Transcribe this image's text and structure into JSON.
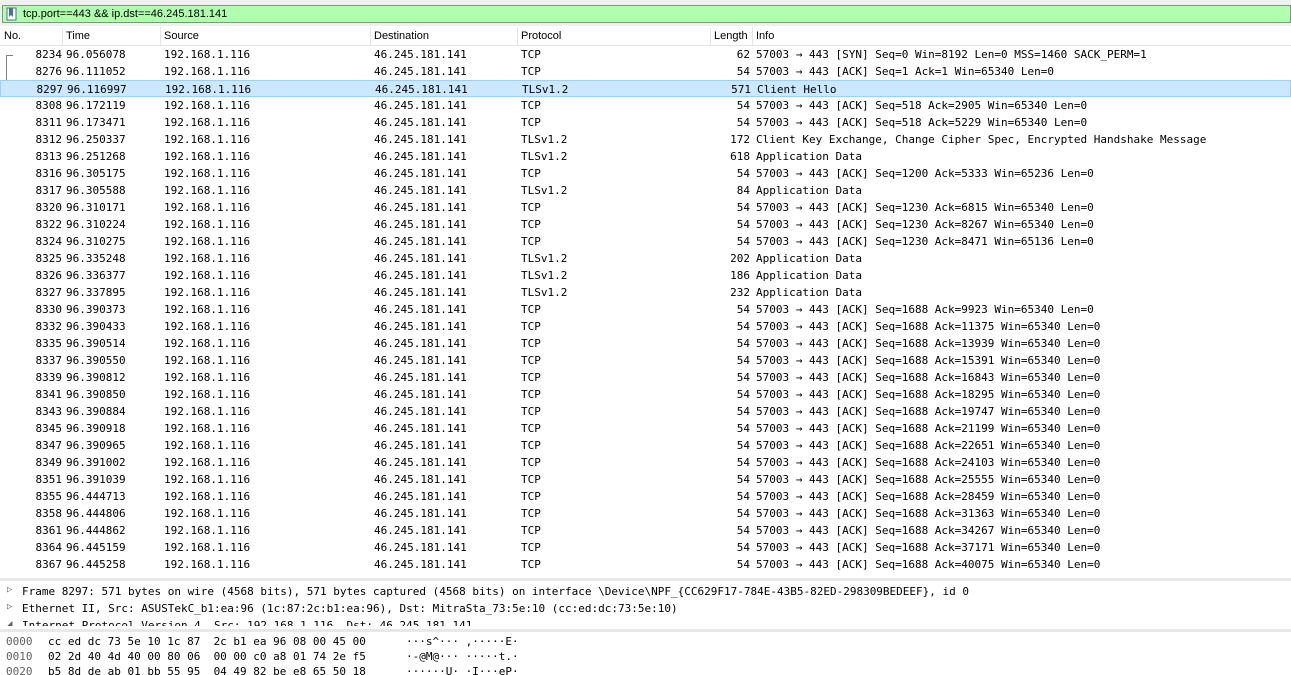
{
  "filter": {
    "value": "tcp.port==443 && ip.dst==46.245.181.141",
    "color": "#afffaf"
  },
  "columns": {
    "no": "No.",
    "time": "Time",
    "source": "Source",
    "destination": "Destination",
    "protocol": "Protocol",
    "length": "Length",
    "info": "Info"
  },
  "packets": [
    {
      "no": "8234",
      "time": "96.056078",
      "source": "192.168.1.116",
      "destination": "46.245.181.141",
      "protocol": "TCP",
      "length": "62",
      "info": "57003 → 443 [SYN] Seq=0 Win=8192 Len=0 MSS=1460 SACK_PERM=1"
    },
    {
      "no": "8276",
      "time": "96.111052",
      "source": "192.168.1.116",
      "destination": "46.245.181.141",
      "protocol": "TCP",
      "length": "54",
      "info": "57003 → 443 [ACK] Seq=1 Ack=1 Win=65340 Len=0"
    },
    {
      "no": "8297",
      "time": "96.116997",
      "source": "192.168.1.116",
      "destination": "46.245.181.141",
      "protocol": "TLSv1.2",
      "length": "571",
      "info": "Client Hello"
    },
    {
      "no": "8308",
      "time": "96.172119",
      "source": "192.168.1.116",
      "destination": "46.245.181.141",
      "protocol": "TCP",
      "length": "54",
      "info": "57003 → 443 [ACK] Seq=518 Ack=2905 Win=65340 Len=0"
    },
    {
      "no": "8311",
      "time": "96.173471",
      "source": "192.168.1.116",
      "destination": "46.245.181.141",
      "protocol": "TCP",
      "length": "54",
      "info": "57003 → 443 [ACK] Seq=518 Ack=5229 Win=65340 Len=0"
    },
    {
      "no": "8312",
      "time": "96.250337",
      "source": "192.168.1.116",
      "destination": "46.245.181.141",
      "protocol": "TLSv1.2",
      "length": "172",
      "info": "Client Key Exchange, Change Cipher Spec, Encrypted Handshake Message"
    },
    {
      "no": "8313",
      "time": "96.251268",
      "source": "192.168.1.116",
      "destination": "46.245.181.141",
      "protocol": "TLSv1.2",
      "length": "618",
      "info": "Application Data"
    },
    {
      "no": "8316",
      "time": "96.305175",
      "source": "192.168.1.116",
      "destination": "46.245.181.141",
      "protocol": "TCP",
      "length": "54",
      "info": "57003 → 443 [ACK] Seq=1200 Ack=5333 Win=65236 Len=0"
    },
    {
      "no": "8317",
      "time": "96.305588",
      "source": "192.168.1.116",
      "destination": "46.245.181.141",
      "protocol": "TLSv1.2",
      "length": "84",
      "info": "Application Data"
    },
    {
      "no": "8320",
      "time": "96.310171",
      "source": "192.168.1.116",
      "destination": "46.245.181.141",
      "protocol": "TCP",
      "length": "54",
      "info": "57003 → 443 [ACK] Seq=1230 Ack=6815 Win=65340 Len=0"
    },
    {
      "no": "8322",
      "time": "96.310224",
      "source": "192.168.1.116",
      "destination": "46.245.181.141",
      "protocol": "TCP",
      "length": "54",
      "info": "57003 → 443 [ACK] Seq=1230 Ack=8267 Win=65340 Len=0"
    },
    {
      "no": "8324",
      "time": "96.310275",
      "source": "192.168.1.116",
      "destination": "46.245.181.141",
      "protocol": "TCP",
      "length": "54",
      "info": "57003 → 443 [ACK] Seq=1230 Ack=8471 Win=65136 Len=0"
    },
    {
      "no": "8325",
      "time": "96.335248",
      "source": "192.168.1.116",
      "destination": "46.245.181.141",
      "protocol": "TLSv1.2",
      "length": "202",
      "info": "Application Data"
    },
    {
      "no": "8326",
      "time": "96.336377",
      "source": "192.168.1.116",
      "destination": "46.245.181.141",
      "protocol": "TLSv1.2",
      "length": "186",
      "info": "Application Data"
    },
    {
      "no": "8327",
      "time": "96.337895",
      "source": "192.168.1.116",
      "destination": "46.245.181.141",
      "protocol": "TLSv1.2",
      "length": "232",
      "info": "Application Data"
    },
    {
      "no": "8330",
      "time": "96.390373",
      "source": "192.168.1.116",
      "destination": "46.245.181.141",
      "protocol": "TCP",
      "length": "54",
      "info": "57003 → 443 [ACK] Seq=1688 Ack=9923 Win=65340 Len=0"
    },
    {
      "no": "8332",
      "time": "96.390433",
      "source": "192.168.1.116",
      "destination": "46.245.181.141",
      "protocol": "TCP",
      "length": "54",
      "info": "57003 → 443 [ACK] Seq=1688 Ack=11375 Win=65340 Len=0"
    },
    {
      "no": "8335",
      "time": "96.390514",
      "source": "192.168.1.116",
      "destination": "46.245.181.141",
      "protocol": "TCP",
      "length": "54",
      "info": "57003 → 443 [ACK] Seq=1688 Ack=13939 Win=65340 Len=0"
    },
    {
      "no": "8337",
      "time": "96.390550",
      "source": "192.168.1.116",
      "destination": "46.245.181.141",
      "protocol": "TCP",
      "length": "54",
      "info": "57003 → 443 [ACK] Seq=1688 Ack=15391 Win=65340 Len=0"
    },
    {
      "no": "8339",
      "time": "96.390812",
      "source": "192.168.1.116",
      "destination": "46.245.181.141",
      "protocol": "TCP",
      "length": "54",
      "info": "57003 → 443 [ACK] Seq=1688 Ack=16843 Win=65340 Len=0"
    },
    {
      "no": "8341",
      "time": "96.390850",
      "source": "192.168.1.116",
      "destination": "46.245.181.141",
      "protocol": "TCP",
      "length": "54",
      "info": "57003 → 443 [ACK] Seq=1688 Ack=18295 Win=65340 Len=0"
    },
    {
      "no": "8343",
      "time": "96.390884",
      "source": "192.168.1.116",
      "destination": "46.245.181.141",
      "protocol": "TCP",
      "length": "54",
      "info": "57003 → 443 [ACK] Seq=1688 Ack=19747 Win=65340 Len=0"
    },
    {
      "no": "8345",
      "time": "96.390918",
      "source": "192.168.1.116",
      "destination": "46.245.181.141",
      "protocol": "TCP",
      "length": "54",
      "info": "57003 → 443 [ACK] Seq=1688 Ack=21199 Win=65340 Len=0"
    },
    {
      "no": "8347",
      "time": "96.390965",
      "source": "192.168.1.116",
      "destination": "46.245.181.141",
      "protocol": "TCP",
      "length": "54",
      "info": "57003 → 443 [ACK] Seq=1688 Ack=22651 Win=65340 Len=0"
    },
    {
      "no": "8349",
      "time": "96.391002",
      "source": "192.168.1.116",
      "destination": "46.245.181.141",
      "protocol": "TCP",
      "length": "54",
      "info": "57003 → 443 [ACK] Seq=1688 Ack=24103 Win=65340 Len=0"
    },
    {
      "no": "8351",
      "time": "96.391039",
      "source": "192.168.1.116",
      "destination": "46.245.181.141",
      "protocol": "TCP",
      "length": "54",
      "info": "57003 → 443 [ACK] Seq=1688 Ack=25555 Win=65340 Len=0"
    },
    {
      "no": "8355",
      "time": "96.444713",
      "source": "192.168.1.116",
      "destination": "46.245.181.141",
      "protocol": "TCP",
      "length": "54",
      "info": "57003 → 443 [ACK] Seq=1688 Ack=28459 Win=65340 Len=0"
    },
    {
      "no": "8358",
      "time": "96.444806",
      "source": "192.168.1.116",
      "destination": "46.245.181.141",
      "protocol": "TCP",
      "length": "54",
      "info": "57003 → 443 [ACK] Seq=1688 Ack=31363 Win=65340 Len=0"
    },
    {
      "no": "8361",
      "time": "96.444862",
      "source": "192.168.1.116",
      "destination": "46.245.181.141",
      "protocol": "TCP",
      "length": "54",
      "info": "57003 → 443 [ACK] Seq=1688 Ack=34267 Win=65340 Len=0"
    },
    {
      "no": "8364",
      "time": "96.445159",
      "source": "192.168.1.116",
      "destination": "46.245.181.141",
      "protocol": "TCP",
      "length": "54",
      "info": "57003 → 443 [ACK] Seq=1688 Ack=37171 Win=65340 Len=0"
    },
    {
      "no": "8367",
      "time": "96.445258",
      "source": "192.168.1.116",
      "destination": "46.245.181.141",
      "protocol": "TCP",
      "length": "54",
      "info": "57003 → 443 [ACK] Seq=1688 Ack=40075 Win=65340 Len=0"
    }
  ],
  "selected_packet": "8297",
  "details": [
    {
      "expander": "collapsed",
      "text": "Frame 8297: 571 bytes on wire (4568 bits), 571 bytes captured (4568 bits) on interface \\Device\\NPF_{CC629F17-784E-43B5-82ED-298309BEDEEF}, id 0"
    },
    {
      "expander": "collapsed",
      "text": "Ethernet II, Src: ASUSTekC_b1:ea:96 (1c:87:2c:b1:ea:96), Dst: MitraSta_73:5e:10 (cc:ed:dc:73:5e:10)"
    },
    {
      "expander": "expanded",
      "text": "Internet Protocol Version 4, Src: 192.168.1.116, Dst: 46.245.181.141"
    }
  ],
  "bytes": [
    {
      "offset": "0000",
      "hex": "cc ed dc 73 5e 10 1c 87  2c b1 ea 96 08 00 45 00",
      "ascii": "···s^··· ,·····E·"
    },
    {
      "offset": "0010",
      "hex": "02 2d 40 4d 40 00 80 06  00 00 c0 a8 01 74 2e f5",
      "ascii": "·-@M@··· ·····t.·"
    },
    {
      "offset": "0020",
      "hex": "b5 8d de ab 01 bb 55 95  04 49 82 be e8 65 50 18",
      "ascii": "······U· ·I···eP·"
    }
  ],
  "colors": {
    "selected_row_bg": "#cce8ff",
    "filter_valid_bg": "#afffaf"
  }
}
